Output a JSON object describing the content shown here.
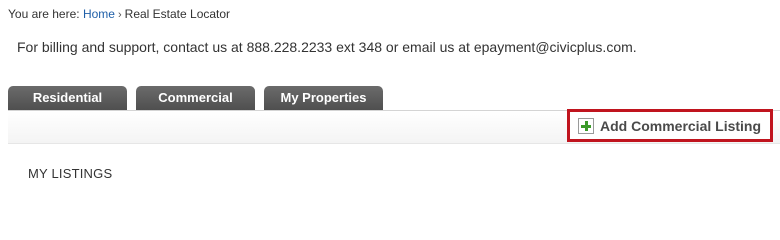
{
  "breadcrumb": {
    "prefix": "You are here:",
    "home_link": "Home",
    "separator": "›",
    "current": "Real Estate Locator"
  },
  "support_text": "For billing and support, contact us at 888.228.2233 ext 348 or email us at epayment@civicplus.com.",
  "tabs": [
    {
      "label": "Residential"
    },
    {
      "label": "Commercial"
    },
    {
      "label": "My Properties"
    }
  ],
  "actions": {
    "add_commercial_label": "Add Commercial Listing",
    "add_icon": "plus-icon",
    "highlight_color": "#c0141e",
    "icon_color": "#3c9a2a"
  },
  "section": {
    "title": "MY LISTINGS"
  }
}
